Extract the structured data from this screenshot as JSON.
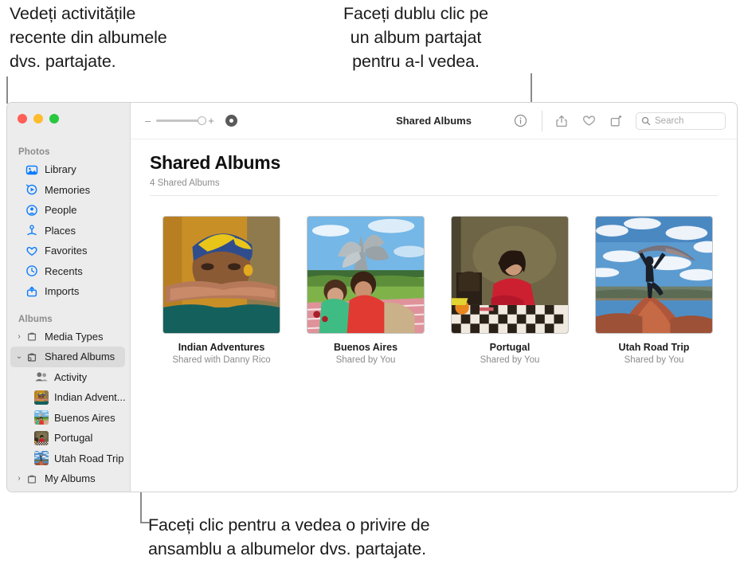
{
  "callouts": {
    "left": "Vedeți activitățile\nrecente din albumele\ndvs. partajate.",
    "right": "Faceți dublu clic pe\nun album partajat\npentru a-l vedea.",
    "bottom": "Faceți clic pentru a vedea o privire de\nansamblu a albumelor dvs. partajate."
  },
  "window": {
    "traffic_lights": [
      "close",
      "minimize",
      "zoom"
    ]
  },
  "toolbar": {
    "zoom_out_label": "–",
    "zoom_in_label": "+",
    "title": "Shared Albums",
    "info_icon": "info-icon",
    "share_icon": "share-icon",
    "favorite_icon": "heart-icon",
    "rotate_icon": "rotate-icon",
    "search_placeholder": "Search"
  },
  "sidebar": {
    "sections": [
      {
        "title": "Photos",
        "items": [
          {
            "label": "Library",
            "icon": "library-icon"
          },
          {
            "label": "Memories",
            "icon": "memories-icon"
          },
          {
            "label": "People",
            "icon": "people-icon"
          },
          {
            "label": "Places",
            "icon": "places-icon"
          },
          {
            "label": "Favorites",
            "icon": "heart-icon"
          },
          {
            "label": "Recents",
            "icon": "clock-icon"
          },
          {
            "label": "Imports",
            "icon": "import-icon"
          }
        ]
      },
      {
        "title": "Albums",
        "items": [
          {
            "label": "Media Types",
            "icon": "album-icon",
            "twisty": "›",
            "selected": false
          },
          {
            "label": "Shared Albums",
            "icon": "shared-album-icon",
            "twisty": "⌄",
            "selected": true
          },
          {
            "label": "My Albums",
            "icon": "album-icon",
            "twisty": "›",
            "selected": false
          }
        ],
        "children": [
          {
            "label": "Activity",
            "icon": "people-pair-icon"
          },
          {
            "label": "Indian Advent...",
            "icon": "thumb-indian"
          },
          {
            "label": "Buenos Aires",
            "icon": "thumb-buenos"
          },
          {
            "label": "Portugal",
            "icon": "thumb-portugal"
          },
          {
            "label": "Utah Road Trip",
            "icon": "thumb-utah"
          }
        ]
      }
    ]
  },
  "main": {
    "title": "Shared Albums",
    "subtitle": "4 Shared Albums",
    "albums": [
      {
        "name": "Indian Adventures",
        "meta": "Shared with Danny Rico",
        "thumb": "indian"
      },
      {
        "name": "Buenos Aires",
        "meta": "Shared by You",
        "thumb": "buenos"
      },
      {
        "name": "Portugal",
        "meta": "Shared by You",
        "thumb": "portugal"
      },
      {
        "name": "Utah Road Trip",
        "meta": "Shared by You",
        "thumb": "utah"
      }
    ]
  },
  "colors": {
    "accent": "#0a7cff",
    "sidebar_bg": "#ececec",
    "selected_row": "#dbdbdb",
    "leader_line": "#8a8a8a"
  }
}
